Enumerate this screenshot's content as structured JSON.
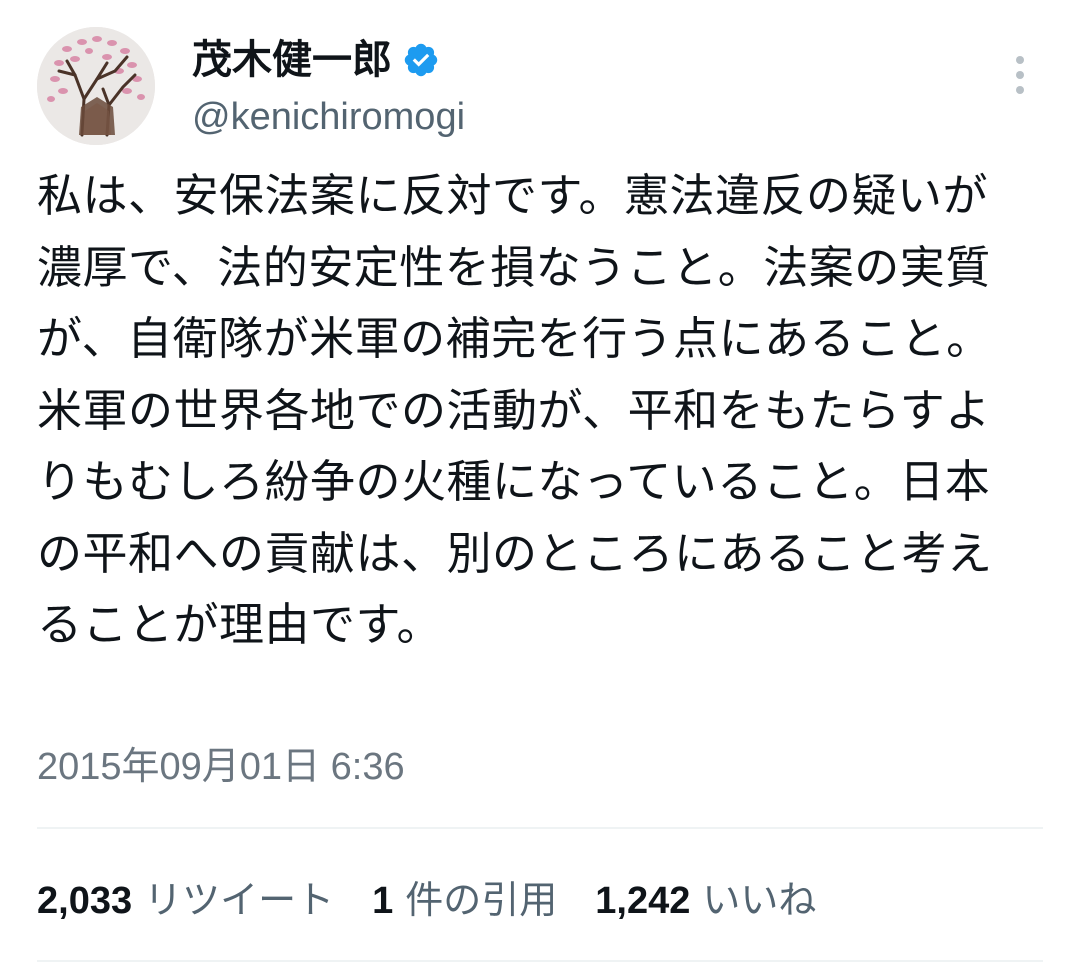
{
  "user": {
    "display_name": "茂木健一郎",
    "handle": "@kenichiromogi",
    "verified": true,
    "verified_color": "#1d9bf0",
    "avatar_icon": "tree-drawing-avatar"
  },
  "menu": {
    "icon": "more-vertical-icon"
  },
  "tweet": {
    "text": "私は、安保法案に反対です。憲法違反の疑いが濃厚で、法的安定性を損なうこと。法案の実質が、自衛隊が米軍の補完を行う点にあること。米軍の世界各地での活動が、平和をもたらすよりもむしろ紛争の火種になっていること。日本の平和への貢献は、別のところにあること考えることが理由です。",
    "timestamp": "2015年09月01日 6:36"
  },
  "stats": [
    {
      "count": "2,033",
      "label": "リツイート"
    },
    {
      "count": "1",
      "label": "件の引用"
    },
    {
      "count": "1,242",
      "label": "いいね"
    }
  ]
}
